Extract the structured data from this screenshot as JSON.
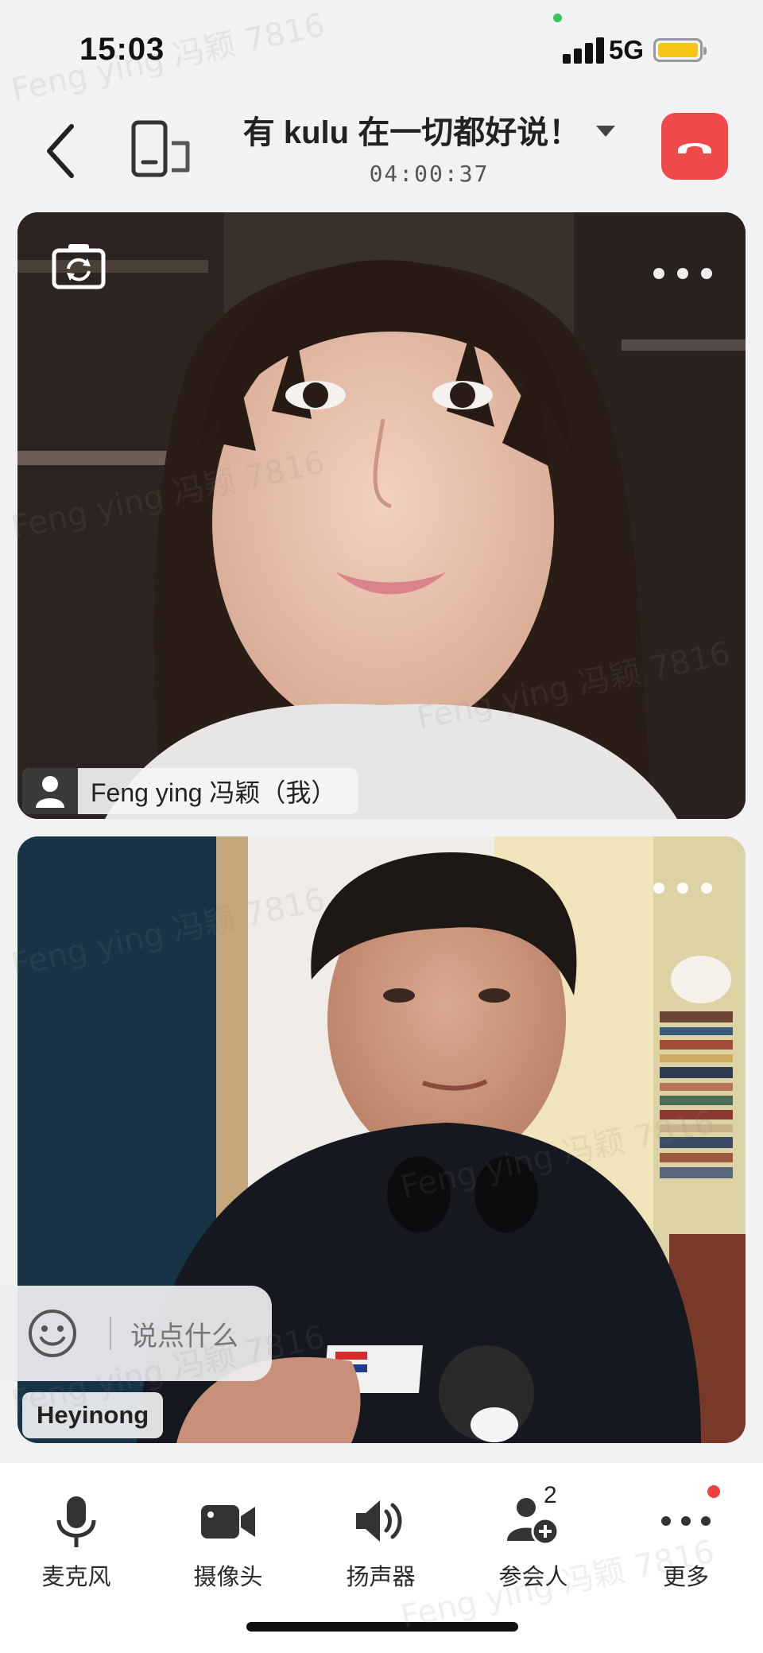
{
  "status": {
    "time": "15:03",
    "network": "5G"
  },
  "header": {
    "title": "有 kulu 在一切都好说！",
    "timer": "04:00:37"
  },
  "tiles": [
    {
      "name": "Feng ying 冯颖（我）"
    },
    {
      "name": "Heyinong"
    }
  ],
  "chat": {
    "placeholder": "说点什么"
  },
  "toolbar": {
    "items": [
      {
        "label": "麦克风"
      },
      {
        "label": "摄像头"
      },
      {
        "label": "扬声器"
      },
      {
        "label": "参会人",
        "count": "2"
      },
      {
        "label": "更多"
      }
    ]
  },
  "watermark": "Feng ying 冯颖 7816",
  "colors": {
    "hangup": "#f04949",
    "battery": "#f5c516",
    "status_dot": "#37c45a",
    "notification_dot": "#f04040"
  }
}
